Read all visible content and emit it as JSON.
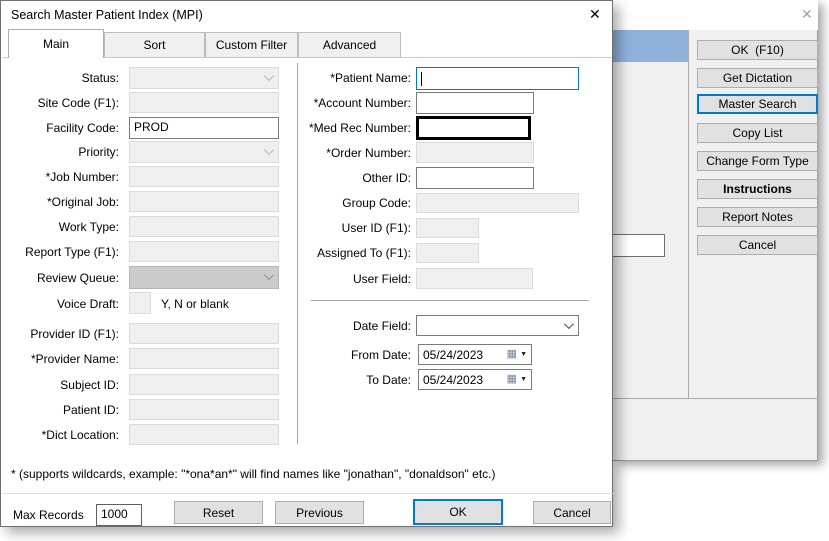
{
  "dialog": {
    "title": "Search Master Patient Index (MPI)",
    "close_glyph": "✕",
    "tabs": [
      "Main",
      "Sort",
      "Custom Filter",
      "Advanced"
    ],
    "left": [
      {
        "label": "Status:",
        "value": ""
      },
      {
        "label": "Site Code (F1):",
        "value": ""
      },
      {
        "label": "Facility Code:",
        "value": "PROD"
      },
      {
        "label": "Priority:",
        "value": ""
      },
      {
        "label": "*Job Number:",
        "value": ""
      },
      {
        "label": "*Original Job:",
        "value": ""
      },
      {
        "label": "Work Type:",
        "value": ""
      },
      {
        "label": "Report Type (F1):",
        "value": ""
      },
      {
        "label": "Review Queue:",
        "value": ""
      },
      {
        "label": "Voice Draft:",
        "value": "",
        "hint": "Y, N or blank"
      },
      {
        "label": "Provider ID (F1):",
        "value": ""
      },
      {
        "label": "*Provider Name:",
        "value": ""
      },
      {
        "label": "Subject ID:",
        "value": ""
      },
      {
        "label": "Patient ID:",
        "value": ""
      },
      {
        "label": "*Dict Location:",
        "value": ""
      }
    ],
    "right": [
      {
        "label": "*Patient Name:",
        "value": ""
      },
      {
        "label": "*Account Number:",
        "value": ""
      },
      {
        "label": "*Med Rec Number:",
        "value": ""
      },
      {
        "label": "*Order Number:",
        "value": ""
      },
      {
        "label": "Other ID:",
        "value": ""
      },
      {
        "label": "Group Code:",
        "value": ""
      },
      {
        "label": "User ID (F1):",
        "value": ""
      },
      {
        "label": "Assigned To (F1):",
        "value": ""
      },
      {
        "label": "User Field:",
        "value": ""
      },
      {
        "label": "Date Field:",
        "value": ""
      },
      {
        "label": "From Date:",
        "value": "05/24/2023"
      },
      {
        "label": "To Date:",
        "value": "05/24/2023"
      }
    ],
    "note": "* (supports wildcards, example: \"*ona*an*\" will find names like \"jonathan\", \"donaldson\" etc.)",
    "footer": {
      "max_records_label": "Max Records",
      "max_records_value": "1000",
      "reset": "Reset",
      "previous": "Previous",
      "ok": "OK",
      "cancel": "Cancel"
    }
  },
  "background_window": {
    "close_glyph": "✕",
    "buttons": [
      "OK  (F10)",
      "Get Dictation",
      "Master Search",
      "Copy List",
      "Change Form Type",
      "Instructions",
      "Report Notes",
      "Cancel"
    ]
  },
  "icons": {
    "calendar_glyph": "▦",
    "dropdown_glyph": "▼"
  },
  "colors": {
    "accent_focus": "#0078d7",
    "selection_bar": "#8fb1dc",
    "button_face": "#e1e1e1",
    "disabled_field": "#efefef",
    "review_queue_field": "#cccccc"
  }
}
